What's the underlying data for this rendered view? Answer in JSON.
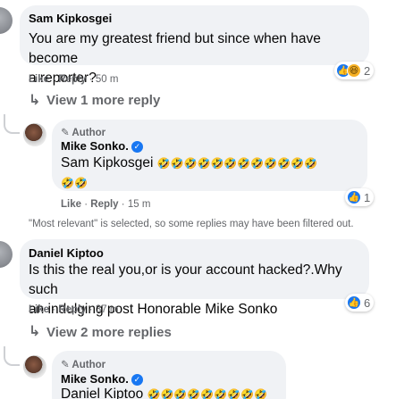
{
  "comments": [
    {
      "author": "Sam Kipkosgei",
      "text_line1": "You are my greatest friend but since when have become",
      "text_line2": "a reporter?",
      "like_label": "Like",
      "reply_label": "Reply",
      "time": "50 m",
      "reaction_count": "2",
      "view_more": "View 1 more reply"
    },
    {
      "author": "Daniel Kiptoo",
      "text_line1": "Is this the real you,or is your account hacked?.Why such",
      "text_line2": "an indulging post Honorable Mike Sonko",
      "like_label": "Like",
      "reply_label": "Reply",
      "time": "37 m",
      "reaction_count": "6",
      "view_more": "View 2 more replies"
    }
  ],
  "replies": [
    {
      "badge": "Author",
      "author": "Mike Sonko.",
      "mention": "Sam Kipkosgei",
      "emoji_line1": "🤣🤣🤣🤣🤣🤣🤣🤣🤣🤣🤣🤣",
      "emoji_line2": "🤣🤣",
      "like_label": "Like",
      "reply_label": "Reply",
      "time": "15 m",
      "reaction_count": "1"
    },
    {
      "badge": "Author",
      "author": "Mike Sonko.",
      "mention": "Daniel Kiptoo",
      "emoji_line1": "🤣🤣🤣🤣🤣🤣🤣🤣🤣"
    }
  ],
  "filter_note": "\"Most relevant\" is selected, so some replies may have been filtered out.",
  "separator": "·",
  "icons": {
    "like": "like-reaction-icon",
    "haha": "haha-reaction-icon",
    "reply_arrow": "reply-arrow-icon",
    "pencil": "pencil-icon",
    "verified": "verified-badge-icon"
  },
  "colors": {
    "bubble": "#f0f2f5",
    "meta_text": "#65676b",
    "like_blue": "#1877f2",
    "haha_yellow": "#f7b125"
  }
}
